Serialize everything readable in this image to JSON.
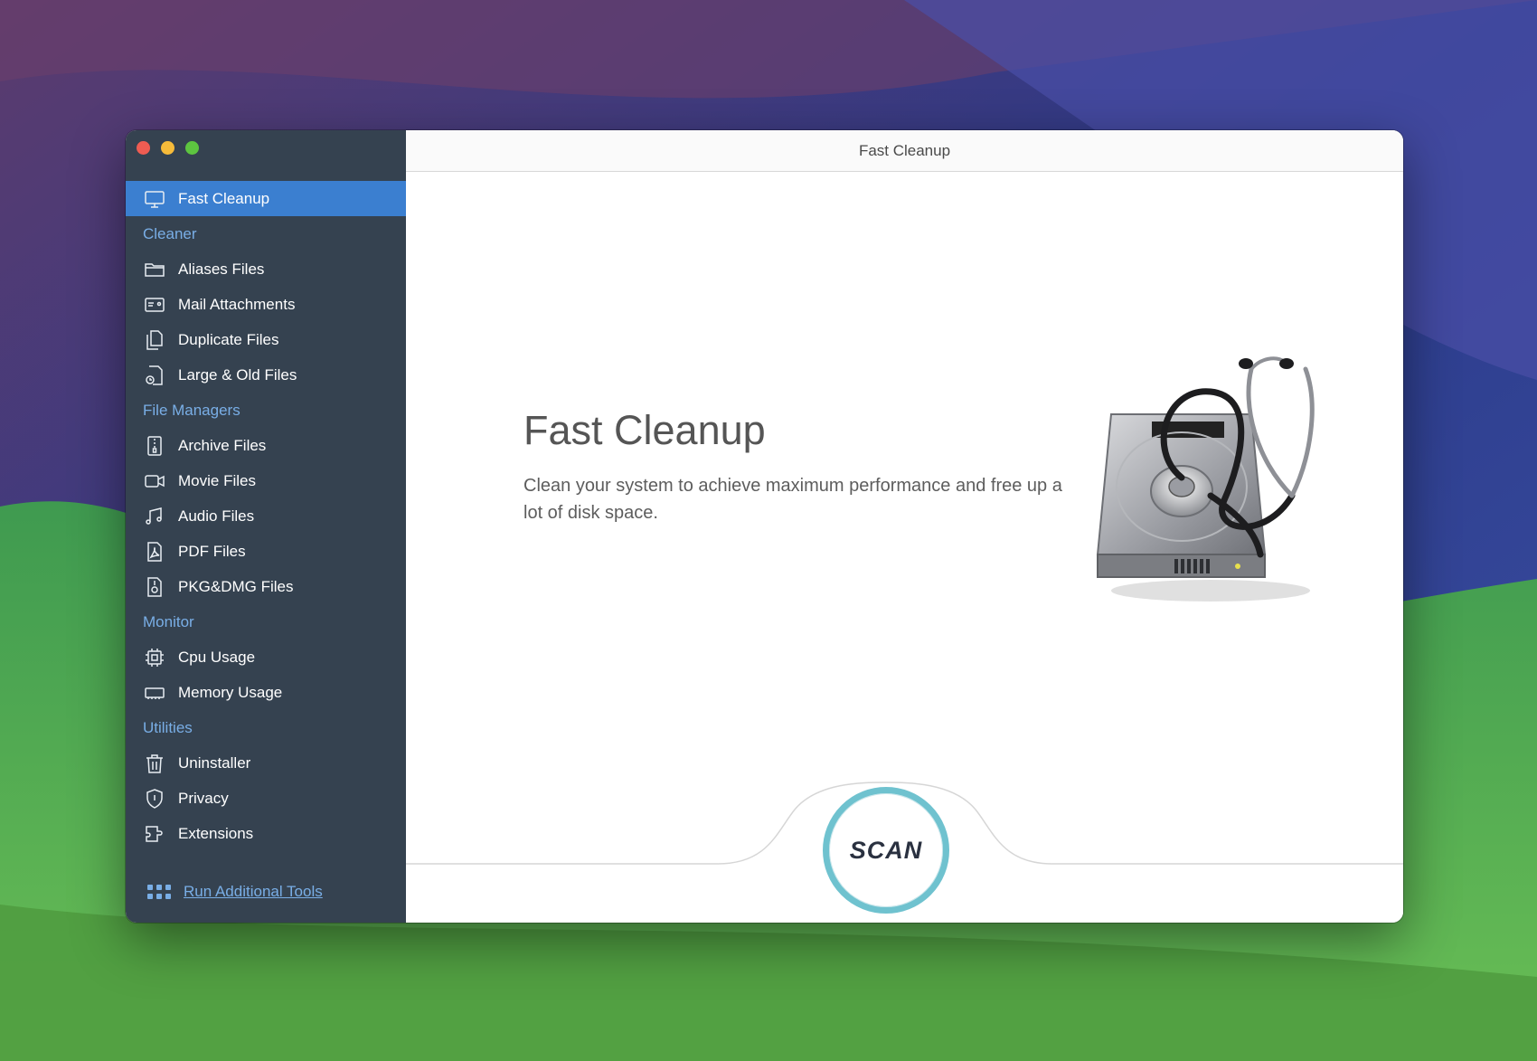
{
  "window": {
    "title": "Fast Cleanup"
  },
  "sidebar": {
    "active": {
      "label": "Fast Cleanup",
      "icon": "monitor-icon"
    },
    "sections": [
      {
        "header": "Cleaner",
        "items": [
          {
            "label": "Aliases Files",
            "icon": "folder-icon"
          },
          {
            "label": "Mail Attachments",
            "icon": "mail-card-icon"
          },
          {
            "label": "Duplicate Files",
            "icon": "duplicate-icon"
          },
          {
            "label": "Large & Old Files",
            "icon": "clock-file-icon"
          }
        ]
      },
      {
        "header": "File Managers",
        "items": [
          {
            "label": "Archive Files",
            "icon": "archive-icon"
          },
          {
            "label": "Movie Files",
            "icon": "video-icon"
          },
          {
            "label": "Audio Files",
            "icon": "music-icon"
          },
          {
            "label": "PDF Files",
            "icon": "pdf-icon"
          },
          {
            "label": "PKG&DMG Files",
            "icon": "package-icon"
          }
        ]
      },
      {
        "header": "Monitor",
        "items": [
          {
            "label": "Cpu Usage",
            "icon": "cpu-icon"
          },
          {
            "label": "Memory Usage",
            "icon": "memory-icon"
          }
        ]
      },
      {
        "header": "Utilities",
        "items": [
          {
            "label": "Uninstaller",
            "icon": "trash-icon"
          },
          {
            "label": "Privacy",
            "icon": "shield-icon"
          },
          {
            "label": "Extensions",
            "icon": "extension-icon"
          }
        ]
      }
    ],
    "footer_link": "Run Additional Tools"
  },
  "main": {
    "heading": "Fast Cleanup",
    "description": "Clean your system to achieve maximum performance and free up a lot of disk space.",
    "scan_label": "SCAN"
  },
  "colors": {
    "sidebar_bg": "#354250",
    "active_bg": "#3b7fd0",
    "section_header": "#79aee6",
    "scan_ring": "#6fc2cf"
  }
}
